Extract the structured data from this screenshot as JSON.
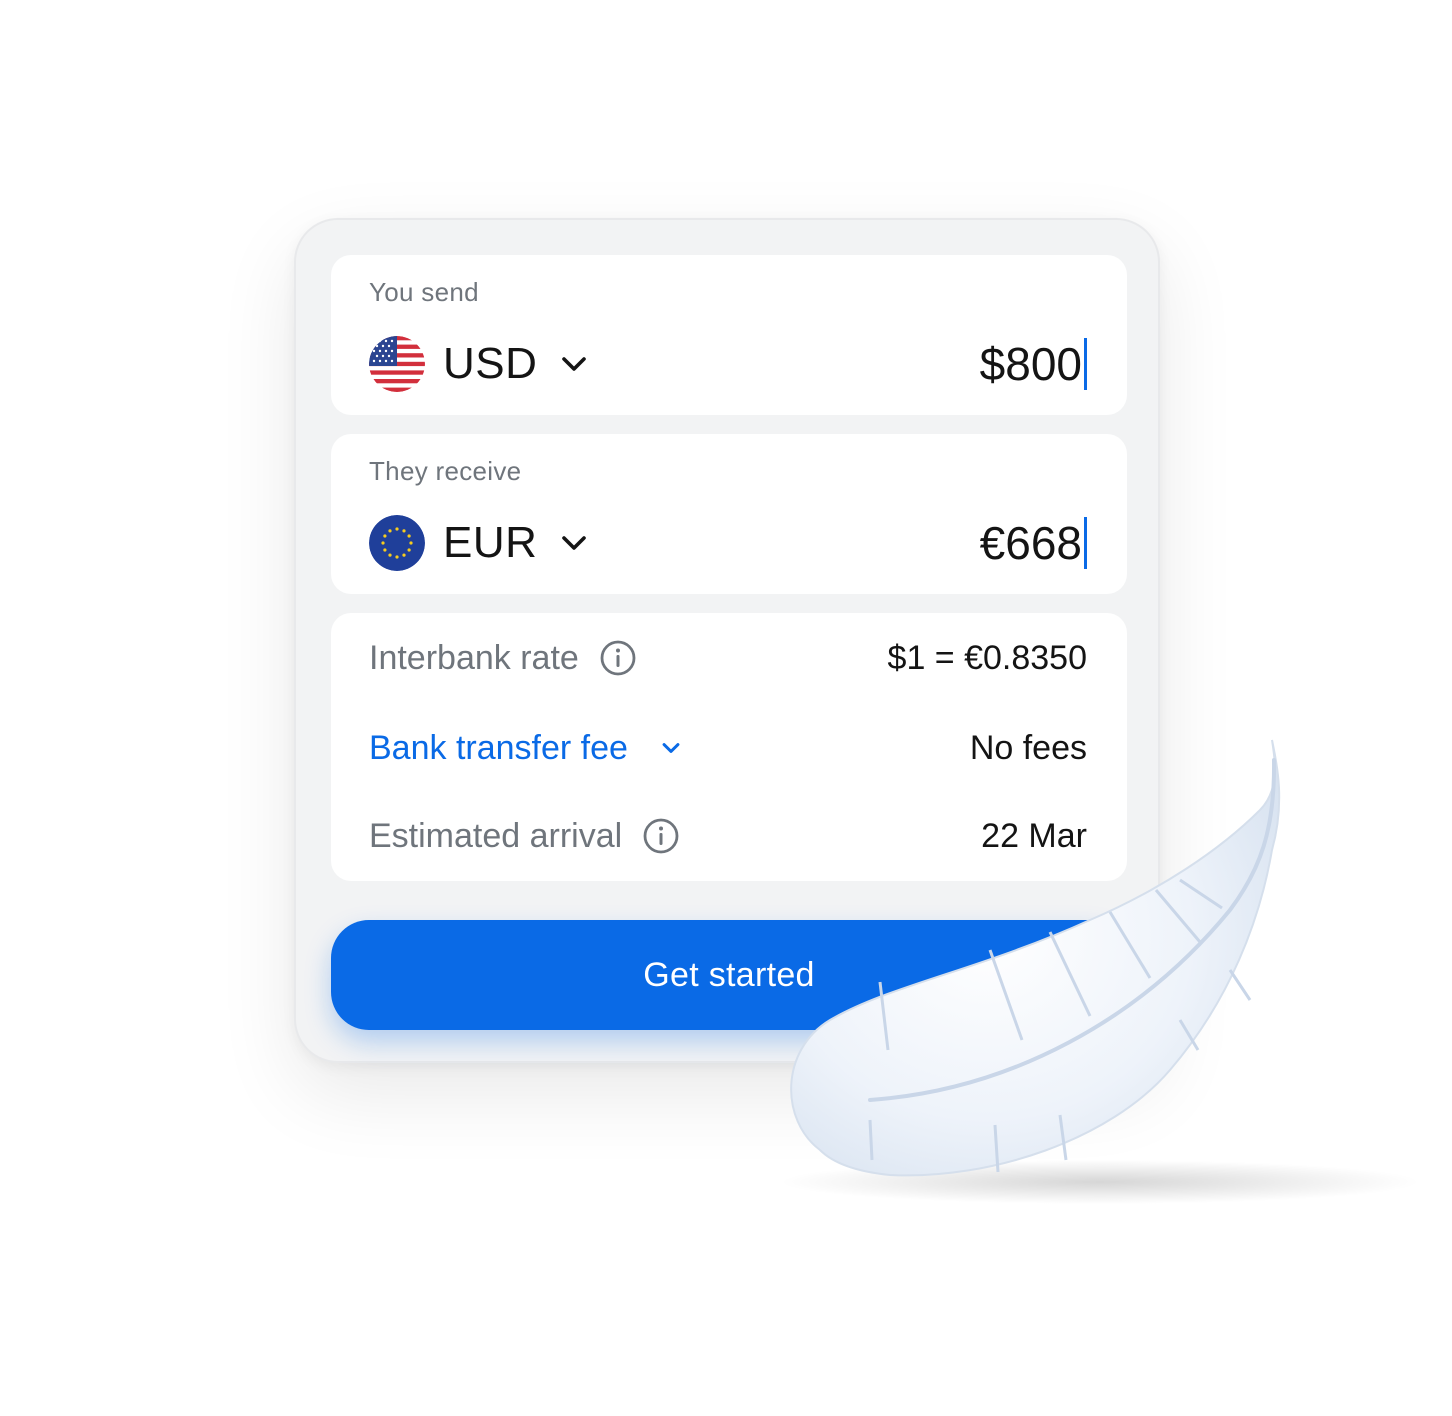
{
  "send": {
    "label": "You send",
    "currency": "USD",
    "flag_icon": "us-flag-icon",
    "amount": "$800"
  },
  "receive": {
    "label": "They receive",
    "currency": "EUR",
    "flag_icon": "eu-flag-icon",
    "amount": "€668"
  },
  "details": {
    "interbank_rate": {
      "label": "Interbank rate",
      "value": "$1 = €0.8350",
      "icon": "info-icon"
    },
    "bank_transfer_fee": {
      "label": "Bank transfer fee",
      "value": "No fees",
      "icon": "chevron-down-icon"
    },
    "estimated_arrival": {
      "label": "Estimated arrival",
      "value": "22 Mar",
      "icon": "info-icon"
    }
  },
  "cta": {
    "label": "Get started"
  },
  "decoration": {
    "icon": "feather-illustration"
  },
  "colors": {
    "accent": "#0a6ae6",
    "card_bg": "#f2f3f4",
    "panel_bg": "#ffffff",
    "muted_text": "#6f757c",
    "text": "#141414"
  }
}
